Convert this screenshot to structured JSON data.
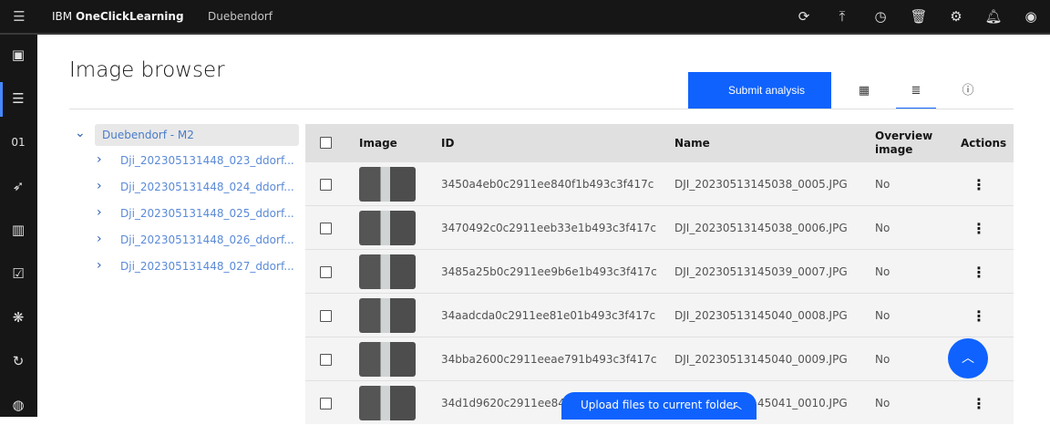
{
  "topbar": {
    "brand_prefix": "IBM",
    "brand_name": "OneClickLearning",
    "project": "Duebendorf",
    "icons": [
      "refresh-document-icon",
      "upload-icon",
      "schedule-icon",
      "trash-icon",
      "settings-icon",
      "notification-icon",
      "user-avatar-icon"
    ]
  },
  "sidebar": {
    "icons": [
      "datasets-icon",
      "image-browser-icon",
      "labeling-icon",
      "deploy-icon",
      "catalog-icon",
      "tasks-icon",
      "model-icon",
      "history-icon",
      "palette-icon"
    ],
    "active_index": 1
  },
  "page": {
    "title": "Image browser",
    "submit_label": "Submit analysis"
  },
  "view_tabs": [
    {
      "icon": "grid-view-icon",
      "active": false
    },
    {
      "icon": "list-view-icon",
      "active": true
    },
    {
      "icon": "info-icon",
      "active": false
    }
  ],
  "tree": {
    "root": "Duebendorf - M2",
    "children": [
      "Dji_202305131448_023_ddorf...",
      "Dji_202305131448_024_ddorf...",
      "Dji_202305131448_025_ddorf...",
      "Dji_202305131448_026_ddorf...",
      "Dji_202305131448_027_ddorf..."
    ]
  },
  "table": {
    "headers": {
      "image": "Image",
      "id": "ID",
      "name": "Name",
      "overview": "Overview image",
      "actions": "Actions"
    },
    "rows": [
      {
        "id": "3450a4eb0c2911ee840f1b493c3f417c",
        "name": "DJI_20230513145038_0005.JPG",
        "overview": "No"
      },
      {
        "id": "3470492c0c2911eeb33e1b493c3f417c",
        "name": "DJI_20230513145038_0006.JPG",
        "overview": "No"
      },
      {
        "id": "3485a25b0c2911ee9b6e1b493c3f417c",
        "name": "DJI_20230513145039_0007.JPG",
        "overview": "No"
      },
      {
        "id": "34aadcda0c2911ee81e01b493c3f417c",
        "name": "DJI_20230513145040_0008.JPG",
        "overview": "No"
      },
      {
        "id": "34bba2600c2911eeae791b493c3f417c",
        "name": "DJI_20230513145040_0009.JPG",
        "overview": "No"
      },
      {
        "id": "34d1d9620c2911ee84",
        "name": "DJI_20230513145041_0010.JPG",
        "overview": "No"
      }
    ]
  },
  "upload": {
    "label": "Upload files to current folder"
  },
  "colors": {
    "accent": "#0f62fe",
    "topbar": "#161616",
    "tree_link": "#5a8ad8"
  }
}
